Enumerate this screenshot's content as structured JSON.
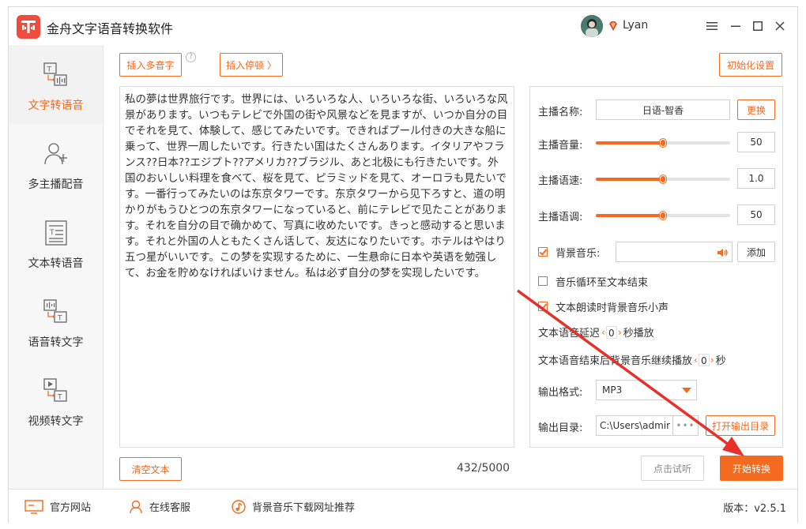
{
  "window": {
    "title": "金舟文字语音转换软件"
  },
  "user": {
    "name": "Lyan"
  },
  "sidebar": {
    "items": [
      {
        "label": "文字转语音",
        "active": true
      },
      {
        "label": "多主播配音",
        "active": false
      },
      {
        "label": "文本转语音",
        "active": false
      },
      {
        "label": "语音转文字",
        "active": false
      },
      {
        "label": "视频转文字",
        "active": false
      }
    ]
  },
  "toolbar": {
    "insert_polyphone": "插入多音字",
    "insert_pause": "插入停顿 〉",
    "reset_settings": "初始化设置"
  },
  "editor": {
    "text": "私の夢は世界旅行です。世界には、いろいろな人、いろいろな街、いろいろな风景があります。いつもテレビで外国の街や风景などを見ますが、いつか自分の目でそれを見て、体験して、感じてみたいです。できればプール付きの大きな船に乗って、世界一周したいです。行きたい国はたくさんあります。イタリアやフランス??日本??エジプト??アメリカ??ブラジル、あと北极にも行きたいです。外国のおいしい料理を食べて、桜を見て、ピラミッドを見て、オーロラも見たいです。一番行ってみたいのは东京タワーです。东京タワーから见下ろすと、道の明かりがもうひとつの东京タワーになっていると、前にテレビで见たことがあります。それを自分の目で确かめて、写真に收めたいです。きっと感动すると思います。それと外国の人ともたくさん话して、友达になりたいです。ホテルはやはり五つ星がいいです。この梦を实现するために、一生悬命に日本や英语を勉强して、お金を貯めなければいけません。私は必ず自分の梦を实现したいです。",
    "counter": "432/5000",
    "clear_label": "清空文本"
  },
  "settings": {
    "voice_label": "主播名称:",
    "voice_value": "日语-智香",
    "change_label": "更换",
    "volume_label": "主播音量:",
    "volume_value": "50",
    "volume_level": 0.5,
    "speed_label": "主播语速:",
    "speed_value": "1.0",
    "speed_level": 0.5,
    "pitch_label": "主播语调:",
    "pitch_value": "50",
    "pitch_level": 0.5,
    "bg_music_label": "背景音乐:",
    "bg_music_checked": true,
    "add_label": "添加",
    "loop_label": "音乐循环至文本结束",
    "loop_checked": false,
    "duck_label": "文本朗读时背景音乐小声",
    "duck_checked": true,
    "delay_prefix": "文本语音延迟",
    "delay_value": "0",
    "delay_suffix": "秒播放",
    "continue_prefix": "文本语音结束后背景音乐继续播放",
    "continue_value": "0",
    "continue_suffix": "秒",
    "format_label": "输出格式:",
    "format_value": "MP3",
    "dir_label": "输出目录:",
    "dir_value": "C:\\Users\\admir",
    "dir_more": "•••",
    "open_dir_label": "打开输出目录"
  },
  "actions": {
    "preview_label": "点击试听",
    "start_label": "开始转换"
  },
  "footer": {
    "website": "官方网站",
    "support": "在线客服",
    "music_rec": "背景音乐下载网址推荐",
    "version": "版本：v2.5.1"
  },
  "colors": {
    "accent": "#f46a1e",
    "logo": "#ee4c3c",
    "annotation": "#e8302a"
  }
}
